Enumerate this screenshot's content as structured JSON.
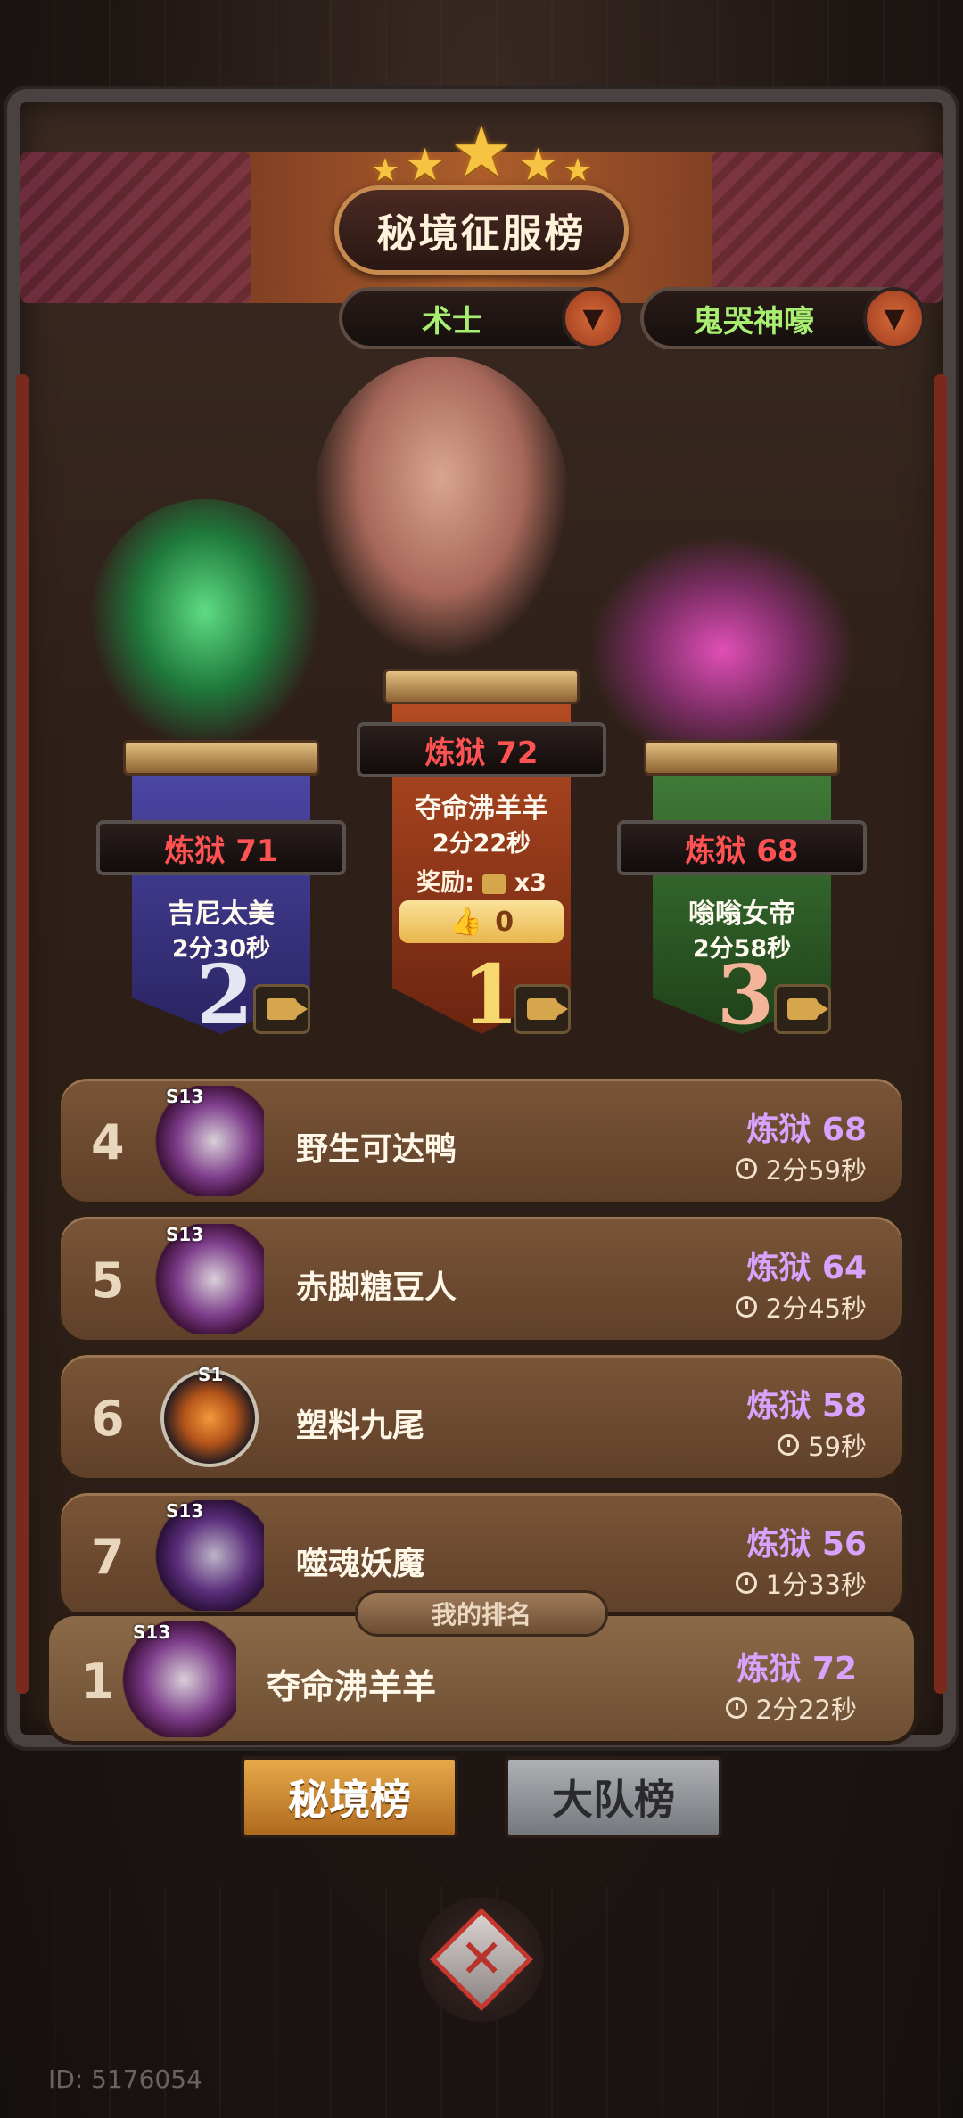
{
  "header": {
    "title": "秘境征服榜",
    "filters": [
      {
        "label": "术士"
      },
      {
        "label": "鬼哭神嚎"
      }
    ]
  },
  "podium": [
    {
      "rank": "2",
      "difficulty": "炼狱 71",
      "name": "吉尼太美",
      "time": "2分30秒",
      "color": "#3d3680"
    },
    {
      "rank": "1",
      "difficulty": "炼狱 72",
      "name": "夺命沸羊羊",
      "time": "2分22秒",
      "reward_label": "奖励:",
      "reward_count": "x3",
      "likes": "0",
      "color": "#8e3a1c"
    },
    {
      "rank": "3",
      "difficulty": "炼狱 68",
      "name": "嗡嗡女帝",
      "time": "2分58秒",
      "color": "#2f5a2a"
    }
  ],
  "list": [
    {
      "rank": "4",
      "season": "S13",
      "name": "野生可达鸭",
      "difficulty": "炼狱 68",
      "time": "2分59秒"
    },
    {
      "rank": "5",
      "season": "S13",
      "name": "赤脚糖豆人",
      "difficulty": "炼狱 64",
      "time": "2分45秒"
    },
    {
      "rank": "6",
      "season": "S1",
      "name": "塑料九尾",
      "difficulty": "炼狱 58",
      "time": "59秒"
    },
    {
      "rank": "7",
      "season": "S13",
      "name": "噬魂妖魔",
      "difficulty": "炼狱 56",
      "time": "1分33秒"
    }
  ],
  "my_rank": {
    "tag": "我的排名",
    "rank": "1",
    "season": "S13",
    "name": "夺命沸羊羊",
    "difficulty": "炼狱 72",
    "time": "2分22秒"
  },
  "tabs": [
    {
      "label": "秘境榜",
      "active": true
    },
    {
      "label": "大队榜",
      "active": false
    }
  ],
  "footer": {
    "user_id": "ID: 5176054"
  },
  "icons": {
    "video": "video-camera-icon",
    "clock": "clock-icon",
    "like": "thumbs-up-icon",
    "close": "close-icon",
    "dropdown": "chevron-down-icon"
  },
  "colors": {
    "difficulty_red": "#ff5252",
    "difficulty_purple": "#d6a4ff",
    "filter_green": "#a8ef71",
    "tab_active": "#e6a949"
  }
}
